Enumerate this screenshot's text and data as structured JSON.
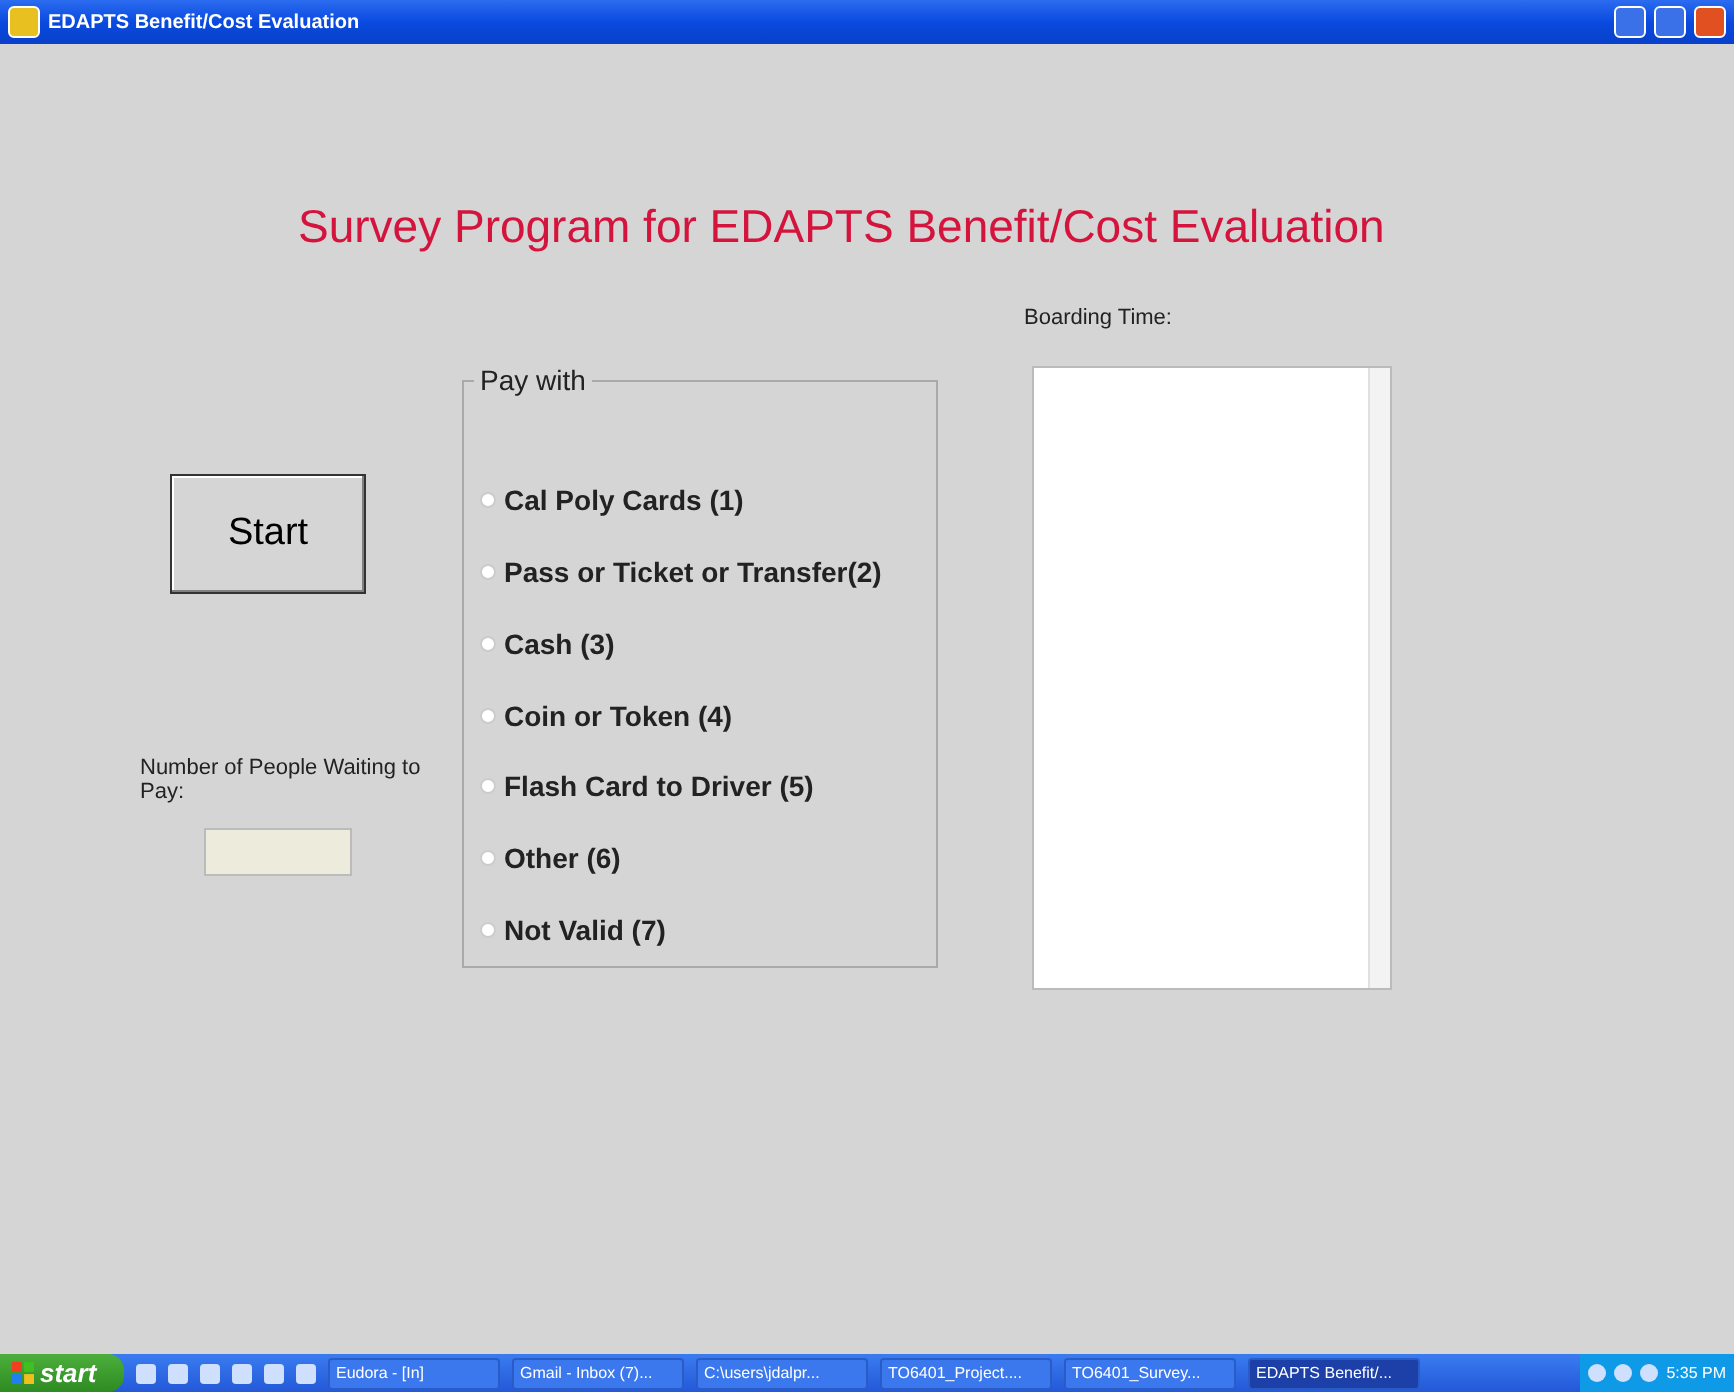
{
  "window": {
    "title": "EDAPTS Benefit/Cost Evaluation"
  },
  "heading": "Survey Program for EDAPTS Benefit/Cost Evaluation",
  "start_button": "Start",
  "waiting": {
    "label": "Number of People Waiting to Pay:"
  },
  "pay_group": {
    "title": "Pay with",
    "options": [
      {
        "label": "Cal Poly Cards (1)",
        "selected": false
      },
      {
        "label": "Pass or Ticket or Transfer(2)",
        "selected": false
      },
      {
        "label": "Cash (3)",
        "selected": false
      },
      {
        "label": "Coin or Token (4)",
        "selected": false
      },
      {
        "label": "Flash Card to Driver (5)",
        "selected": false
      },
      {
        "label": "Other (6)",
        "selected": false
      },
      {
        "label": "Not Valid (7)",
        "selected": false
      }
    ]
  },
  "boarding": {
    "label": "Boarding Time:"
  },
  "taskbar": {
    "start": "start",
    "tasks": [
      {
        "label": "Eudora - [In]",
        "selected": false
      },
      {
        "label": "Gmail - Inbox (7)...",
        "selected": false
      },
      {
        "label": "C:\\users\\jdalpr...",
        "selected": false
      },
      {
        "label": "TO6401_Project....",
        "selected": false
      },
      {
        "label": "TO6401_Survey...",
        "selected": false
      },
      {
        "label": "EDAPTS Benefit/...",
        "selected": true
      }
    ],
    "clock": "5:35 PM"
  }
}
